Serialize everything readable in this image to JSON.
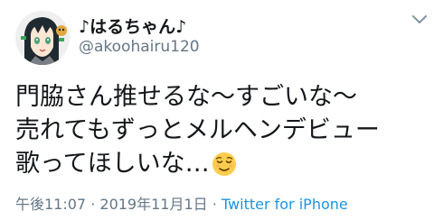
{
  "user": {
    "display_name": "♪はるちゃん♪",
    "handle": "@akoohairu120"
  },
  "tweet": {
    "text": "門脇さん推せるな〜すごいな〜\n売れてもずっとメルヘンデビュー\n歌ってほしいな…",
    "emoji": "relieved-face-icon"
  },
  "meta": {
    "time": "午後11:07",
    "separator": " · ",
    "date": "2019年11月1日",
    "source": "Twitter for iPhone"
  },
  "colors": {
    "text": "#14171a",
    "secondary": "#657786",
    "link": "#1b95e0",
    "emoji_face": "#ffcc4d"
  }
}
